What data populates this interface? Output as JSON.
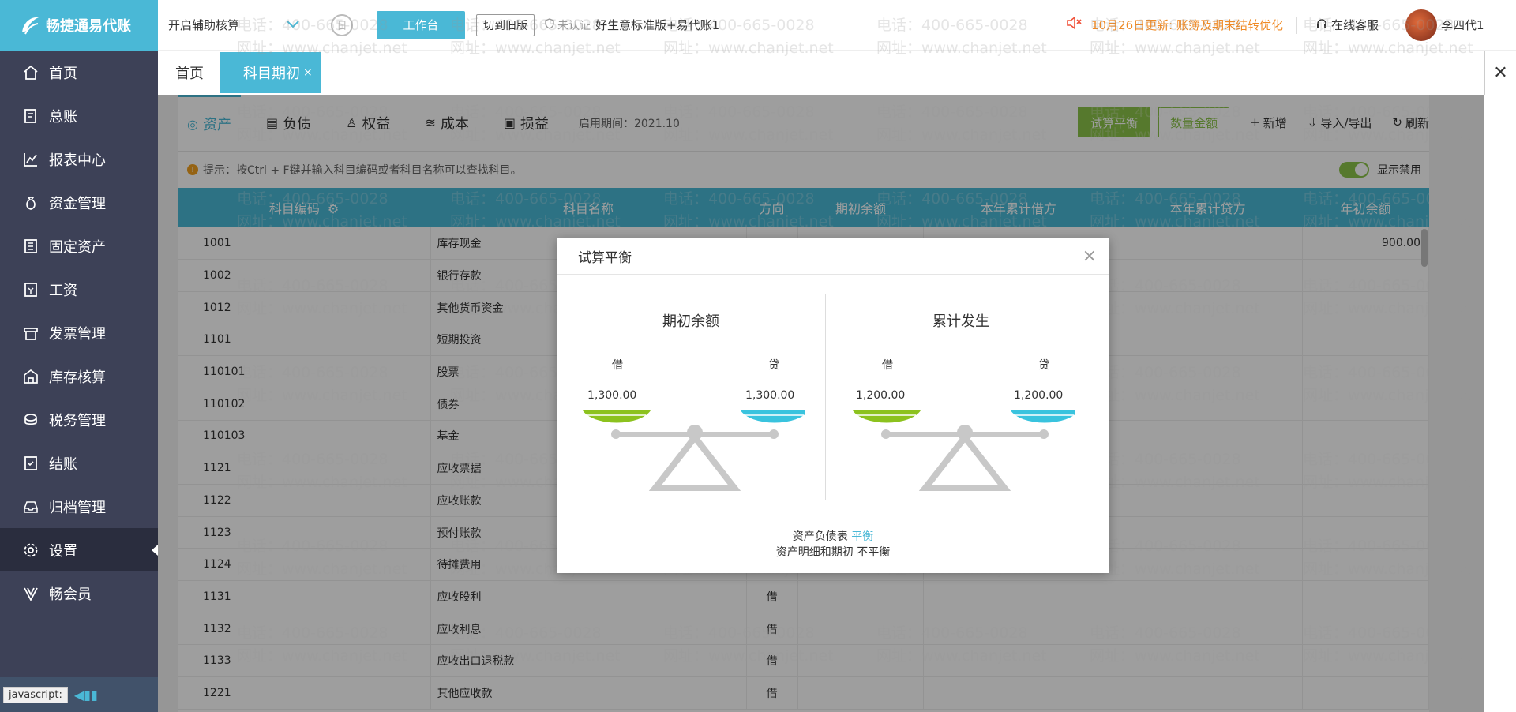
{
  "app": {
    "logo_text": "畅捷通易代账"
  },
  "sidebar": {
    "items": [
      {
        "label": "首页",
        "icon": "home-icon"
      },
      {
        "label": "总账",
        "icon": "ledger-icon"
      },
      {
        "label": "报表中心",
        "icon": "chart-icon"
      },
      {
        "label": "资金管理",
        "icon": "money-bag-icon"
      },
      {
        "label": "固定资产",
        "icon": "building-icon"
      },
      {
        "label": "工资",
        "icon": "salary-icon"
      },
      {
        "label": "发票管理",
        "icon": "invoice-icon"
      },
      {
        "label": "库存核算",
        "icon": "warehouse-icon"
      },
      {
        "label": "税务管理",
        "icon": "tax-icon"
      },
      {
        "label": "结账",
        "icon": "checkout-icon"
      },
      {
        "label": "归档管理",
        "icon": "archive-icon"
      },
      {
        "label": "设置",
        "icon": "gear-icon"
      },
      {
        "label": "畅会员",
        "icon": "vip-icon"
      }
    ],
    "active_index": 11,
    "status_text": "javascript:"
  },
  "header": {
    "assist_label": "开启辅助核算",
    "workbench_label": "工作台",
    "old_version_label": "切到旧版",
    "cert_label": "未认证",
    "company": "好生意标准版+易代账1",
    "notice": "10月26日更新: 账簿及期末结转优化",
    "service_label": "在线客服",
    "user_name": "李四代1"
  },
  "tabs": {
    "home": "首页",
    "active": "科目期初",
    "close_glyph": "×",
    "close_all_glyph": "✕"
  },
  "subtabs": [
    {
      "label": "资产",
      "icon": "asset-icon"
    },
    {
      "label": "负债",
      "icon": "liability-icon"
    },
    {
      "label": "权益",
      "icon": "equity-icon"
    },
    {
      "label": "成本",
      "icon": "cost-icon"
    },
    {
      "label": "损益",
      "icon": "profit-loss-icon"
    }
  ],
  "period": "启用期间：2021.10",
  "actions": {
    "trial_balance": "试算平衡",
    "qty_amount": "数量金额",
    "add": "新增",
    "import_export": "导入/导出",
    "refresh": "刷新"
  },
  "tip": "提示：按Ctrl + F键并输入科目编码或者科目名称可以查找科目。",
  "show_disabled": "显示禁用",
  "table": {
    "headers": [
      "科目编码",
      "科目名称",
      "方向",
      "期初余额",
      "本年累计借方",
      "本年累计贷方",
      "年初余额"
    ],
    "rows": [
      {
        "code": "1001",
        "name": "库存现金",
        "dir": "",
        "year_begin": "900.00"
      },
      {
        "code": "1002",
        "name": "银行存款",
        "dir": "",
        "year_begin": ""
      },
      {
        "code": "1012",
        "name": "其他货币资金",
        "dir": "",
        "year_begin": ""
      },
      {
        "code": "1101",
        "name": "短期投资",
        "dir": "",
        "year_begin": ""
      },
      {
        "code": "110101",
        "name": "股票",
        "dir": "",
        "year_begin": ""
      },
      {
        "code": "110102",
        "name": "债券",
        "dir": "",
        "year_begin": ""
      },
      {
        "code": "110103",
        "name": "基金",
        "dir": "",
        "year_begin": ""
      },
      {
        "code": "1121",
        "name": "应收票据",
        "dir": "",
        "year_begin": ""
      },
      {
        "code": "1122",
        "name": "应收账款",
        "dir": "",
        "year_begin": ""
      },
      {
        "code": "1123",
        "name": "预付账款",
        "dir": "",
        "year_begin": ""
      },
      {
        "code": "1124",
        "name": "待摊费用",
        "dir": "",
        "year_begin": ""
      },
      {
        "code": "1131",
        "name": "应收股利",
        "dir": "借",
        "year_begin": ""
      },
      {
        "code": "1132",
        "name": "应收利息",
        "dir": "借",
        "year_begin": ""
      },
      {
        "code": "1133",
        "name": "应收出口退税款",
        "dir": "借",
        "year_begin": ""
      },
      {
        "code": "1221",
        "name": "其他应收款",
        "dir": "借",
        "year_begin": ""
      }
    ]
  },
  "modal": {
    "title": "试算平衡",
    "close_glyph": "×",
    "left": {
      "title": "期初余额",
      "debit_label": "借",
      "credit_label": "贷",
      "debit": "1,300.00",
      "credit": "1,300.00"
    },
    "right": {
      "title": "累计发生",
      "debit_label": "借",
      "credit_label": "贷",
      "debit": "1,200.00",
      "credit": "1,200.00"
    },
    "footer_line1_prefix": "资产负债表",
    "footer_line1_status": "平衡",
    "footer_line2": "资产明细和期初 不平衡",
    "colors": {
      "debit_pan": "#8cc21e",
      "credit_pan": "#39c3de",
      "beam": "#c8c8c8"
    }
  },
  "watermark": {
    "phone": "电话：400-665-0028",
    "site": "网址：www.chanjet.net"
  }
}
